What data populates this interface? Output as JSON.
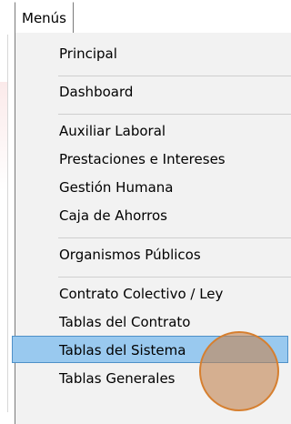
{
  "menu": {
    "title": "Menús",
    "items": [
      {
        "label": "Principal"
      },
      {
        "label": "Dashboard"
      },
      {
        "label": "Auxiliar Laboral"
      },
      {
        "label": "Prestaciones e Intereses"
      },
      {
        "label": "Gestión Humana"
      },
      {
        "label": "Caja de Ahorros"
      },
      {
        "label": "Organismos Públicos"
      },
      {
        "label": "Contrato Colectivo / Ley"
      },
      {
        "label": "Tablas del Contrato"
      },
      {
        "label": "Tablas del Sistema"
      },
      {
        "label": "Tablas Generales"
      }
    ],
    "selected_label": "Tablas del Sistema"
  },
  "colors": {
    "highlight_fill": "#99c9ef",
    "highlight_border": "#4e90c8",
    "menu_background": "#f2f2f2",
    "cursor_ring": "#d67f2f"
  }
}
